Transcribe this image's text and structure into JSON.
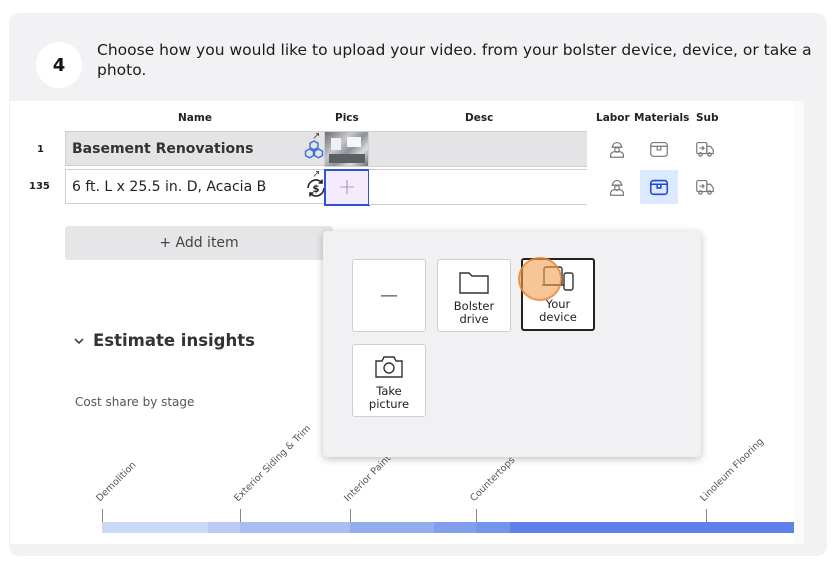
{
  "step": {
    "number": "4",
    "text": "Choose how you would like to upload your video. from your bolster device, device, or take a photo."
  },
  "table": {
    "headers": {
      "name": "Name",
      "pics": "Pics",
      "desc": "Desc",
      "labor": "Labor",
      "materials": "Materials",
      "sub": "Sub"
    },
    "rows": [
      {
        "num": "1",
        "name": "Basement Renovations",
        "icon": "cubes-icon"
      },
      {
        "num": "135",
        "name": "6 ft. L x 25.5 in. D, Acacia B",
        "icon": "dollar-cycle-icon"
      }
    ],
    "add_pic_label": "+",
    "add_item_label": "+ Add item"
  },
  "insights": {
    "title": "Estimate insights",
    "cost_share": "Cost share by stage"
  },
  "upload_popup": {
    "blank_label": "—",
    "options": [
      {
        "label_1": "Bolster",
        "label_2": "drive",
        "icon": "folder-icon"
      },
      {
        "label_1": "Your",
        "label_2": "device",
        "icon": "devices-icon",
        "selected": true
      },
      {
        "label_1": "Take",
        "label_2": "picture",
        "icon": "camera-icon"
      }
    ]
  },
  "stages": [
    "Demolition",
    "Exterior Siding & Trim",
    "Interior Paint",
    "Countertops",
    "Linoleum Flooring"
  ],
  "colors": {
    "accent_blue": "#2f55d4",
    "bar_light": "#c6d4f7",
    "bar_mid": "#9fb6f0",
    "bar_dark": "#5f82ea",
    "click_marker": "#f2a050"
  }
}
